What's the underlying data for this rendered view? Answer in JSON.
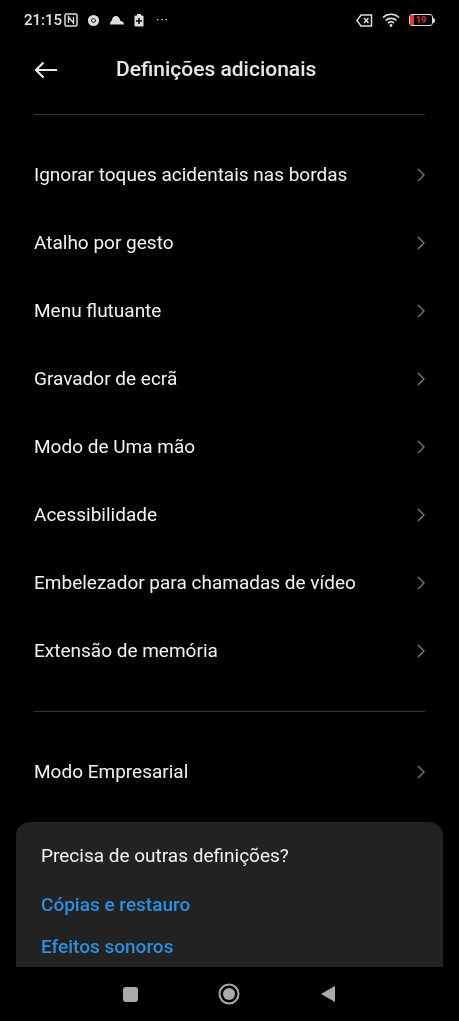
{
  "status_bar": {
    "time": "21:15",
    "more": "···",
    "battery": "19"
  },
  "header": {
    "title": "Definições adicionais"
  },
  "groups": [
    {
      "items": [
        {
          "label": "Ignorar toques acidentais nas bordas"
        },
        {
          "label": "Atalho por gesto"
        },
        {
          "label": "Menu flutuante"
        },
        {
          "label": "Gravador de ecrã"
        },
        {
          "label": "Modo de Uma mão"
        },
        {
          "label": "Acessibilidade"
        },
        {
          "label": "Embelezador para chamadas de vídeo"
        },
        {
          "label": "Extensão de memória"
        }
      ]
    },
    {
      "items": [
        {
          "label": "Modo Empresarial"
        }
      ]
    }
  ],
  "suggestions": {
    "title": "Precisa de outras definições?",
    "links": [
      "Cópias e restauro",
      "Efeitos sonoros"
    ]
  }
}
